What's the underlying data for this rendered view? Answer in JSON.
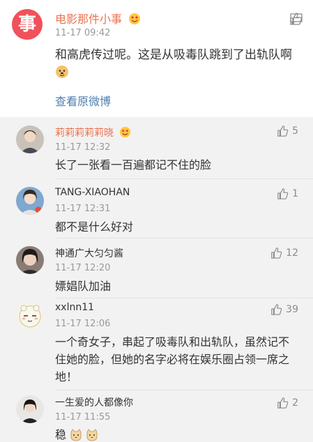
{
  "post": {
    "avatar_char": "事",
    "author": "电影那件小事",
    "time": "11-17 09:42",
    "body": "和高虎传过呢。这是从吸毒队跳到了出轨队啊",
    "view_original": "查看原微博"
  },
  "comments": [
    {
      "name": "莉莉莉莉莉晓",
      "time": "11-17 12:32",
      "text": "长了一张看一百遍都记不住的脸",
      "likes": "5"
    },
    {
      "name": "TANG-XIAOHAN",
      "time": "11-17 12:31",
      "text": "都不是什么好对",
      "likes": "1"
    },
    {
      "name": "神通广大匀匀酱",
      "time": "11-17 12:20",
      "text": "嫖娼队加油",
      "likes": "12"
    },
    {
      "name": "xxlnn11",
      "time": "11-17 12:06",
      "text": "一个奇女子，串起了吸毒队和出轨队，虽然记不住她的脸，但她的名字必将在娱乐圈占领一席之地！",
      "likes": "39"
    },
    {
      "name": "一生爱的人都像你",
      "time": "11-17 11:55",
      "text": "稳",
      "likes": "2"
    }
  ],
  "colors": {
    "accent": "#eb7350",
    "link": "#507daf",
    "avatar_red": "#f0515a"
  }
}
